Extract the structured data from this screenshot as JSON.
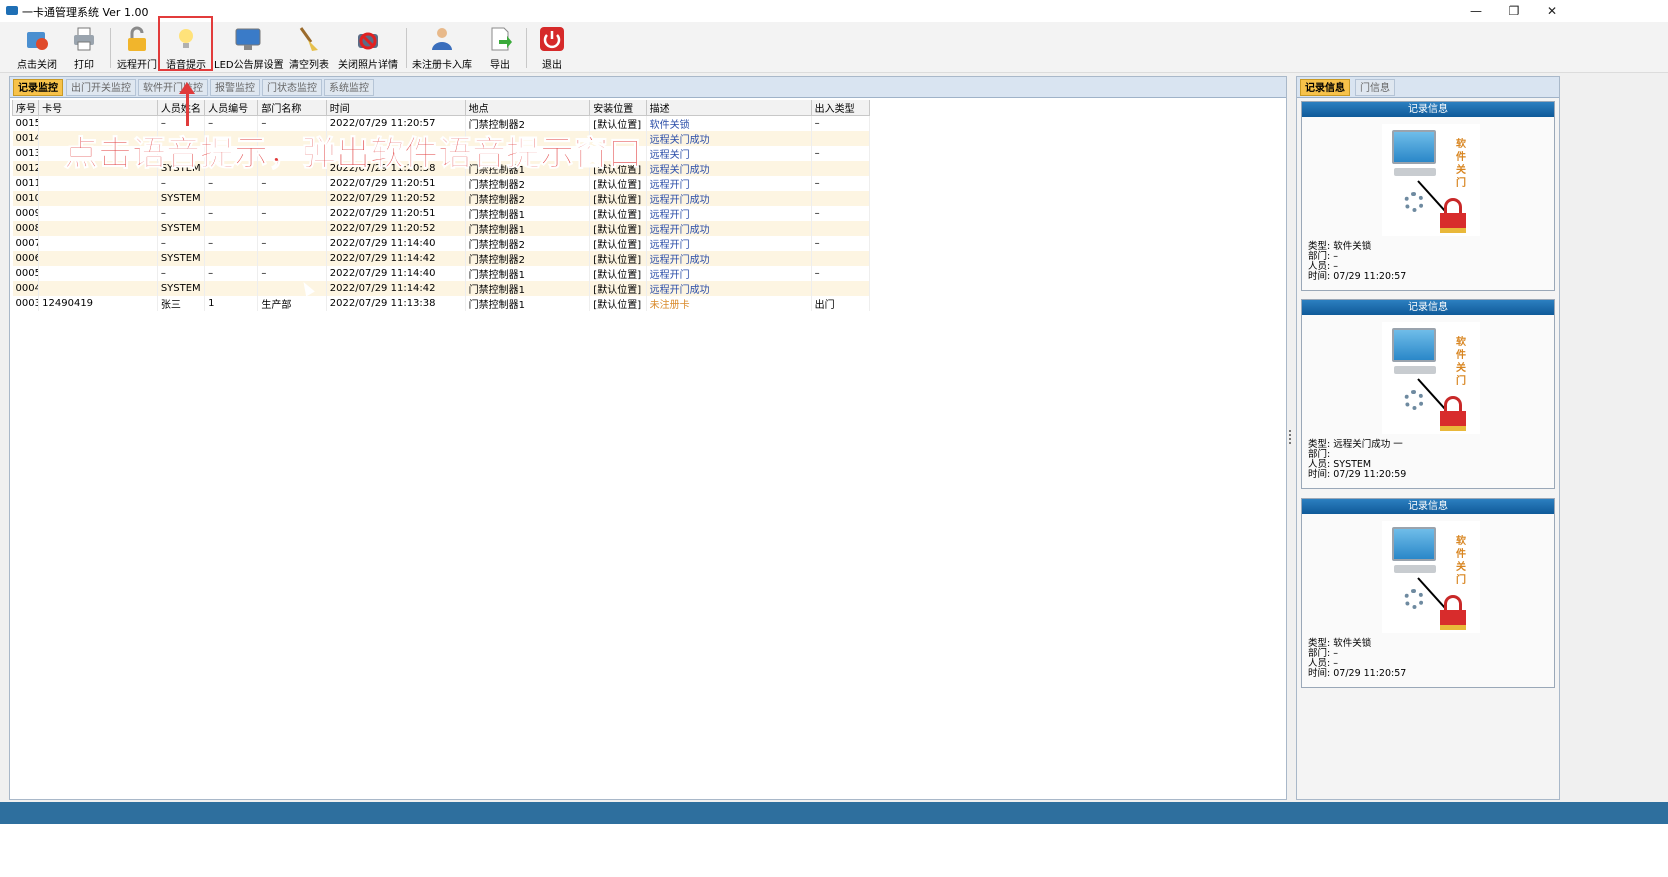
{
  "window": {
    "title": "一卡通管理系统 Ver 1.00",
    "controls": [
      "—",
      "❐",
      "✕"
    ]
  },
  "toolbar": {
    "buttons": [
      {
        "label": "点击关闭",
        "icon": "close-door-icon"
      },
      {
        "label": "打印",
        "icon": "printer-icon"
      },
      {
        "label": "远程开门",
        "icon": "unlock-icon"
      },
      {
        "label": "语音提示",
        "icon": "lightbulb-icon"
      },
      {
        "label": "LED公告屏设置",
        "icon": "led-screen-icon"
      },
      {
        "label": "清空列表",
        "icon": "broom-icon"
      },
      {
        "label": "关闭照片详情",
        "icon": "camera-off-icon"
      },
      {
        "label": "未注册卡入库",
        "icon": "user-card-icon"
      },
      {
        "label": "导出",
        "icon": "export-icon"
      },
      {
        "label": "退出",
        "icon": "power-icon"
      }
    ]
  },
  "colors": {
    "accent": "#f7c24a",
    "link": "#2a4da8",
    "warning": "#d98a2b",
    "annotation": "#e03b3b",
    "header_blue": "#0f5a99"
  },
  "left_tabs": [
    "记录监控",
    "出门开关监控",
    "软件开门监控",
    "报警监控",
    "门状态监控",
    "系统监控"
  ],
  "right_tabs": [
    "记录信息",
    "门信息"
  ],
  "table": {
    "columns": [
      "序号",
      "卡号",
      "人员姓名",
      "人员编号",
      "部门名称",
      "时间",
      "地点",
      "安装位置",
      "描述",
      "出入类型"
    ],
    "rows": [
      [
        "0015",
        "",
        "–",
        "–",
        "–",
        "2022/07/29 11:20:57",
        "门禁控制器2",
        "[默认位置]",
        "软件关锁",
        "–"
      ],
      [
        "0014",
        "",
        "",
        "",
        "",
        "",
        "",
        "",
        "远程关门成功",
        ""
      ],
      [
        "0013",
        "",
        "",
        "",
        "",
        "",
        "",
        "",
        "远程关门",
        "–"
      ],
      [
        "0012",
        "",
        "SYSTEM",
        "",
        "",
        "2022/07/29 11:20:58",
        "门禁控制器1",
        "[默认位置]",
        "远程关门成功",
        ""
      ],
      [
        "0011",
        "",
        "–",
        "–",
        "–",
        "2022/07/29 11:20:51",
        "门禁控制器2",
        "[默认位置]",
        "远程开门",
        "–"
      ],
      [
        "0010",
        "",
        "SYSTEM",
        "",
        "",
        "2022/07/29 11:20:52",
        "门禁控制器2",
        "[默认位置]",
        "远程开门成功",
        ""
      ],
      [
        "0009",
        "",
        "–",
        "–",
        "–",
        "2022/07/29 11:20:51",
        "门禁控制器1",
        "[默认位置]",
        "远程开门",
        "–"
      ],
      [
        "0008",
        "",
        "SYSTEM",
        "",
        "",
        "2022/07/29 11:20:52",
        "门禁控制器1",
        "[默认位置]",
        "远程开门成功",
        ""
      ],
      [
        "0007",
        "",
        "–",
        "–",
        "–",
        "2022/07/29 11:14:40",
        "门禁控制器2",
        "[默认位置]",
        "远程开门",
        "–"
      ],
      [
        "0006",
        "",
        "SYSTEM",
        "",
        "",
        "2022/07/29 11:14:42",
        "门禁控制器2",
        "[默认位置]",
        "远程开门成功",
        ""
      ],
      [
        "0005",
        "",
        "–",
        "–",
        "–",
        "2022/07/29 11:14:40",
        "门禁控制器1",
        "[默认位置]",
        "远程开门",
        "–"
      ],
      [
        "0004",
        "",
        "SYSTEM",
        "",
        "",
        "2022/07/29 11:14:42",
        "门禁控制器1",
        "[默认位置]",
        "远程开门成功",
        ""
      ],
      [
        "0003",
        "12490419",
        "张三",
        "1",
        "生产部",
        "2022/07/29 11:13:38",
        "门禁控制器1",
        "[默认位置]",
        "未注册卡",
        "出门"
      ]
    ]
  },
  "cards": [
    {
      "header": "记录信息",
      "caption": "软件关门",
      "type": "软件关锁",
      "dept": "–",
      "person": "–",
      "time": "07/29 11:20:57"
    },
    {
      "header": "记录信息",
      "caption": "软件关门",
      "type": "远程关门成功 一",
      "dept": "",
      "person": "SYSTEM",
      "time": "07/29 11:20:59"
    },
    {
      "header": "记录信息",
      "caption": "软件关门",
      "type": "软件关锁",
      "dept": "–",
      "person": "–",
      "time": "07/29 11:20:57"
    }
  ],
  "card_labels": {
    "type": "类型:",
    "dept": "部门:",
    "person": "人员:",
    "time": "时间:"
  },
  "annotation": {
    "text": "点击语音提示，弹出软件语音提示窗口"
  }
}
